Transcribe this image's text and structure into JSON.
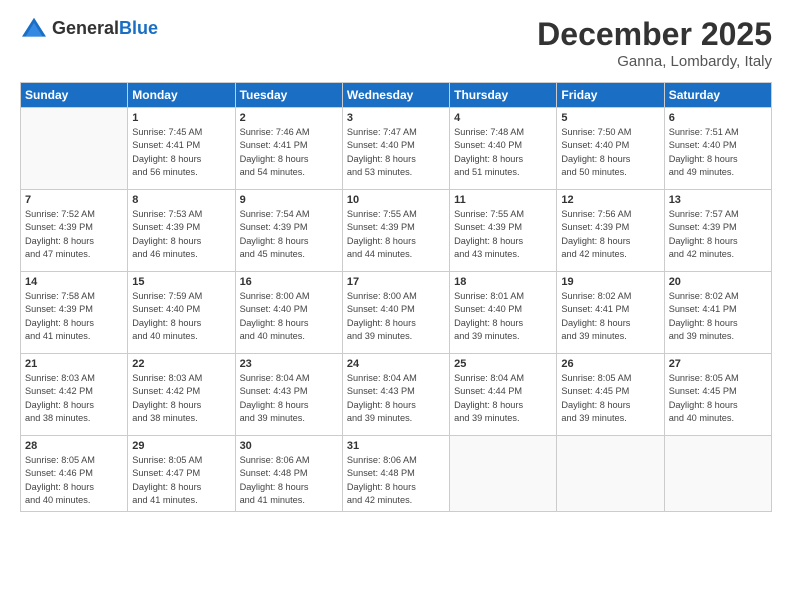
{
  "header": {
    "logo_general": "General",
    "logo_blue": "Blue",
    "month_title": "December 2025",
    "location": "Ganna, Lombardy, Italy"
  },
  "weekdays": [
    "Sunday",
    "Monday",
    "Tuesday",
    "Wednesday",
    "Thursday",
    "Friday",
    "Saturday"
  ],
  "weeks": [
    [
      {
        "day": "",
        "info": ""
      },
      {
        "day": "1",
        "info": "Sunrise: 7:45 AM\nSunset: 4:41 PM\nDaylight: 8 hours\nand 56 minutes."
      },
      {
        "day": "2",
        "info": "Sunrise: 7:46 AM\nSunset: 4:41 PM\nDaylight: 8 hours\nand 54 minutes."
      },
      {
        "day": "3",
        "info": "Sunrise: 7:47 AM\nSunset: 4:40 PM\nDaylight: 8 hours\nand 53 minutes."
      },
      {
        "day": "4",
        "info": "Sunrise: 7:48 AM\nSunset: 4:40 PM\nDaylight: 8 hours\nand 51 minutes."
      },
      {
        "day": "5",
        "info": "Sunrise: 7:50 AM\nSunset: 4:40 PM\nDaylight: 8 hours\nand 50 minutes."
      },
      {
        "day": "6",
        "info": "Sunrise: 7:51 AM\nSunset: 4:40 PM\nDaylight: 8 hours\nand 49 minutes."
      }
    ],
    [
      {
        "day": "7",
        "info": "Sunrise: 7:52 AM\nSunset: 4:39 PM\nDaylight: 8 hours\nand 47 minutes."
      },
      {
        "day": "8",
        "info": "Sunrise: 7:53 AM\nSunset: 4:39 PM\nDaylight: 8 hours\nand 46 minutes."
      },
      {
        "day": "9",
        "info": "Sunrise: 7:54 AM\nSunset: 4:39 PM\nDaylight: 8 hours\nand 45 minutes."
      },
      {
        "day": "10",
        "info": "Sunrise: 7:55 AM\nSunset: 4:39 PM\nDaylight: 8 hours\nand 44 minutes."
      },
      {
        "day": "11",
        "info": "Sunrise: 7:55 AM\nSunset: 4:39 PM\nDaylight: 8 hours\nand 43 minutes."
      },
      {
        "day": "12",
        "info": "Sunrise: 7:56 AM\nSunset: 4:39 PM\nDaylight: 8 hours\nand 42 minutes."
      },
      {
        "day": "13",
        "info": "Sunrise: 7:57 AM\nSunset: 4:39 PM\nDaylight: 8 hours\nand 42 minutes."
      }
    ],
    [
      {
        "day": "14",
        "info": "Sunrise: 7:58 AM\nSunset: 4:39 PM\nDaylight: 8 hours\nand 41 minutes."
      },
      {
        "day": "15",
        "info": "Sunrise: 7:59 AM\nSunset: 4:40 PM\nDaylight: 8 hours\nand 40 minutes."
      },
      {
        "day": "16",
        "info": "Sunrise: 8:00 AM\nSunset: 4:40 PM\nDaylight: 8 hours\nand 40 minutes."
      },
      {
        "day": "17",
        "info": "Sunrise: 8:00 AM\nSunset: 4:40 PM\nDaylight: 8 hours\nand 39 minutes."
      },
      {
        "day": "18",
        "info": "Sunrise: 8:01 AM\nSunset: 4:40 PM\nDaylight: 8 hours\nand 39 minutes."
      },
      {
        "day": "19",
        "info": "Sunrise: 8:02 AM\nSunset: 4:41 PM\nDaylight: 8 hours\nand 39 minutes."
      },
      {
        "day": "20",
        "info": "Sunrise: 8:02 AM\nSunset: 4:41 PM\nDaylight: 8 hours\nand 39 minutes."
      }
    ],
    [
      {
        "day": "21",
        "info": "Sunrise: 8:03 AM\nSunset: 4:42 PM\nDaylight: 8 hours\nand 38 minutes."
      },
      {
        "day": "22",
        "info": "Sunrise: 8:03 AM\nSunset: 4:42 PM\nDaylight: 8 hours\nand 38 minutes."
      },
      {
        "day": "23",
        "info": "Sunrise: 8:04 AM\nSunset: 4:43 PM\nDaylight: 8 hours\nand 39 minutes."
      },
      {
        "day": "24",
        "info": "Sunrise: 8:04 AM\nSunset: 4:43 PM\nDaylight: 8 hours\nand 39 minutes."
      },
      {
        "day": "25",
        "info": "Sunrise: 8:04 AM\nSunset: 4:44 PM\nDaylight: 8 hours\nand 39 minutes."
      },
      {
        "day": "26",
        "info": "Sunrise: 8:05 AM\nSunset: 4:45 PM\nDaylight: 8 hours\nand 39 minutes."
      },
      {
        "day": "27",
        "info": "Sunrise: 8:05 AM\nSunset: 4:45 PM\nDaylight: 8 hours\nand 40 minutes."
      }
    ],
    [
      {
        "day": "28",
        "info": "Sunrise: 8:05 AM\nSunset: 4:46 PM\nDaylight: 8 hours\nand 40 minutes."
      },
      {
        "day": "29",
        "info": "Sunrise: 8:05 AM\nSunset: 4:47 PM\nDaylight: 8 hours\nand 41 minutes."
      },
      {
        "day": "30",
        "info": "Sunrise: 8:06 AM\nSunset: 4:48 PM\nDaylight: 8 hours\nand 41 minutes."
      },
      {
        "day": "31",
        "info": "Sunrise: 8:06 AM\nSunset: 4:48 PM\nDaylight: 8 hours\nand 42 minutes."
      },
      {
        "day": "",
        "info": ""
      },
      {
        "day": "",
        "info": ""
      },
      {
        "day": "",
        "info": ""
      }
    ]
  ]
}
